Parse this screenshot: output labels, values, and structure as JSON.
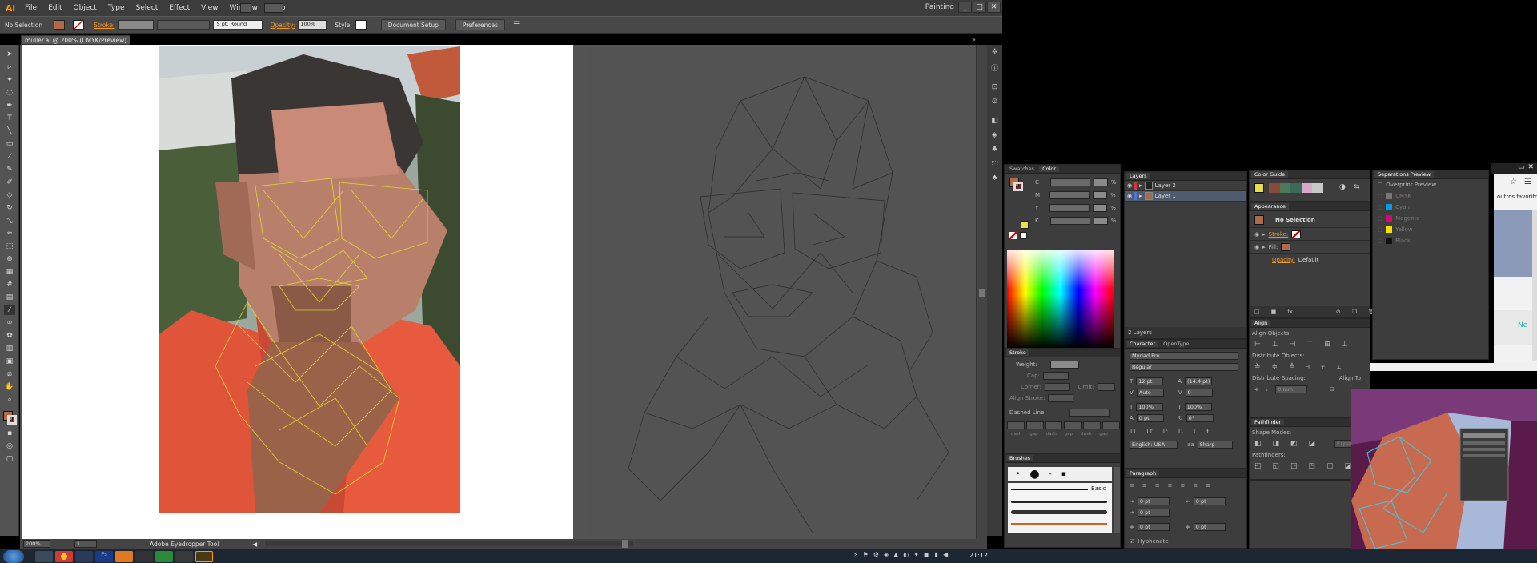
{
  "app": {
    "logo": "Ai",
    "menu": [
      "File",
      "Edit",
      "Object",
      "Type",
      "Select",
      "Effect",
      "View",
      "Window",
      "Help"
    ],
    "workspace": "Painting",
    "window_buttons": [
      "_",
      "□",
      "✕"
    ]
  },
  "control_bar": {
    "selection": "No Selection",
    "stroke_label": "Stroke:",
    "brush": "5 pt. Round",
    "opacity_label": "Opacity:",
    "opacity_value": "100%",
    "style_label": "Style:",
    "document_setup": "Document Setup",
    "preferences": "Preferences"
  },
  "document": {
    "tab_title": "muller.ai @ 200% (CMYK/Preview)",
    "zoom": "200%",
    "page": "1",
    "status_tool": "Adobe Eyedropper Tool"
  },
  "panels": {
    "swatches_tab": "Swatches",
    "color_tab": "Color",
    "color_channels": [
      "C",
      "M",
      "Y",
      "K"
    ],
    "color_percent": "%",
    "stroke": {
      "title": "Stroke",
      "weight_label": "Weight:",
      "cap_label": "Cap:",
      "corner_label": "Corner:",
      "limit_label": "Limit:",
      "align_label": "Align Stroke:",
      "dashed_label": "Dashed Line",
      "dash_labels": [
        "dash",
        "gap",
        "dash",
        "gap",
        "dash",
        "gap"
      ]
    },
    "brushes": {
      "title": "Brushes",
      "basic": "Basic"
    },
    "layers": {
      "title": "Layers",
      "rows": [
        {
          "name": "Layer 2",
          "color": "#cc3a3a"
        },
        {
          "name": "Layer 1",
          "color": "#4a78d8"
        }
      ],
      "footer": "2 Layers"
    },
    "character": {
      "tab": "Character",
      "tab2": "OpenType",
      "font": "Myriad Pro",
      "style": "Regular",
      "size": "12 pt",
      "leading": "(14.4 pt)",
      "kerning": "Auto",
      "tracking": "0",
      "vscale": "100%",
      "hscale": "100%",
      "baseline": "0 pt",
      "rotate": "0°",
      "language": "English: USA",
      "aa": "Sharp"
    },
    "paragraph": {
      "title": "Paragraph",
      "indent_left": "0 pt",
      "indent_right": "0 pt",
      "first_line": "0 pt",
      "space_before": "0 pt",
      "space_after": "0 pt",
      "hyphenate": "Hyphenate"
    },
    "color_guide": {
      "title": "Color Guide"
    },
    "appearance": {
      "title": "Appearance",
      "object": "No Selection",
      "stroke_label": "Stroke:",
      "fill_label": "Fill:",
      "opacity_label": "Opacity:",
      "opacity_value": "Default"
    },
    "align": {
      "title": "Align",
      "align_objects": "Align Objects:",
      "distribute_objects": "Distribute Objects:",
      "distribute_spacing": "Distribute Spacing:",
      "align_to": "Align To:",
      "spacing_value": "0 mm"
    },
    "pathfinder": {
      "title": "Pathfinder",
      "shape_modes": "Shape Modes:",
      "expand": "Expand",
      "pathfinders": "Pathfinders:"
    },
    "separations": {
      "title": "Separations Preview",
      "overprint": "Overprint Preview",
      "inks": [
        {
          "name": "CMYK",
          "color": "#777777"
        },
        {
          "name": "Cyan",
          "color": "#00a0e8"
        },
        {
          "name": "Magenta",
          "color": "#e0007a"
        },
        {
          "name": "Yellow",
          "color": "#f2e400"
        },
        {
          "name": "Black",
          "color": "#111111"
        }
      ]
    }
  },
  "browser": {
    "favorites_label": "outros favoritos",
    "partial": "Ne"
  },
  "taskbar": {
    "time": "21:12"
  }
}
